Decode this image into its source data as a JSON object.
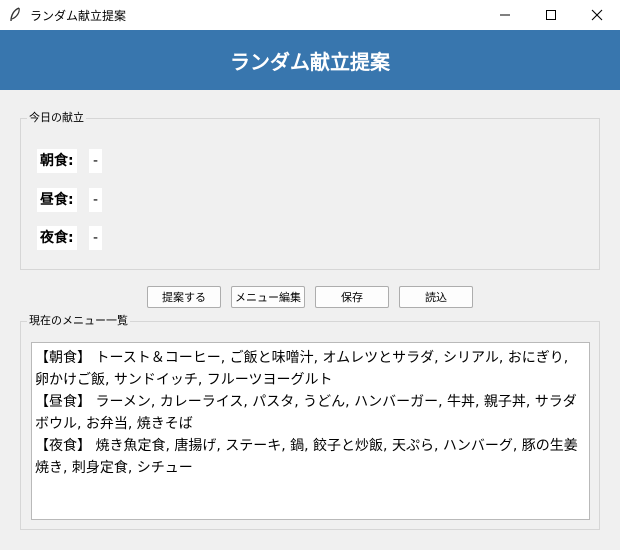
{
  "window": {
    "title": "ランダム献立提案"
  },
  "header": {
    "title": "ランダム献立提案"
  },
  "today": {
    "legend": "今日の献立",
    "breakfast_label": "朝食:",
    "breakfast_value": "-",
    "lunch_label": "昼食:",
    "lunch_value": "-",
    "dinner_label": "夜食:",
    "dinner_value": "-"
  },
  "buttons": {
    "suggest": "提案する",
    "edit_menu": "メニュー編集",
    "save": "保存",
    "load": "読込"
  },
  "menu_list": {
    "legend": "現在のメニュー一覧",
    "text": "【朝食】 トースト＆コーヒー, ご飯と味噌汁, オムレツとサラダ, シリアル, おにぎり, 卵かけご飯, サンドイッチ, フルーツヨーグルト\n【昼食】 ラーメン, カレーライス, パスタ, うどん, ハンバーガー, 牛丼, 親子丼, サラダボウル, お弁当, 焼きそば\n【夜食】 焼き魚定食, 唐揚げ, ステーキ, 鍋, 餃子と炒飯, 天ぷら, ハンバーグ, 豚の生姜焼き, 刺身定食, シチュー"
  },
  "colors": {
    "header_bg": "#3876ae",
    "header_text": "#ffffff",
    "window_bg": "#f0f0f0"
  },
  "icons": {
    "app": "feather-icon",
    "minimize": "minimize-icon",
    "maximize": "maximize-icon",
    "close": "close-icon"
  }
}
